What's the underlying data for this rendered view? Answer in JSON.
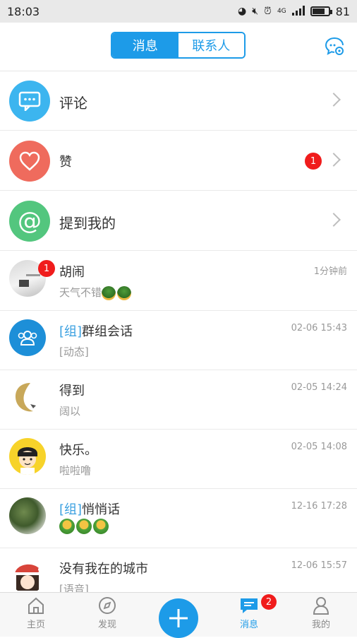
{
  "status_bar": {
    "time": "18:03",
    "network": "4G",
    "battery": "81",
    "battery_level": 0.81
  },
  "header": {
    "tabs": [
      {
        "label": "消息",
        "active": true
      },
      {
        "label": "联系人",
        "active": false
      }
    ],
    "chat_settings_icon": "chat-settings-icon"
  },
  "notifications": [
    {
      "label": "评论",
      "icon": "comment-icon",
      "color": "#3cb5ef",
      "badge": null
    },
    {
      "label": "赞",
      "icon": "heart-icon",
      "color": "#ef6b5d",
      "badge": "1"
    },
    {
      "label": "提到我的",
      "icon": "at-icon",
      "color": "#53c67e",
      "badge": null
    }
  ],
  "conversations": [
    {
      "name": "胡闹",
      "tag": "",
      "preview": "天气不错",
      "time": "1分钟前",
      "badge": "1"
    },
    {
      "name": "群组会话",
      "tag": "[组]",
      "preview": "[动态]",
      "time": "02-06 15:43",
      "badge": null
    },
    {
      "name": "得到",
      "tag": "",
      "preview": "阔以",
      "time": "02-05 14:24",
      "badge": null
    },
    {
      "name": "快乐。",
      "tag": "",
      "preview": "啦啦噜",
      "time": "02-05 14:08",
      "badge": null
    },
    {
      "name": "悄悄话",
      "tag": "[组]",
      "preview": "",
      "time": "12-16 17:28",
      "badge": null
    },
    {
      "name": "没有我在的城市",
      "tag": "",
      "preview": "[语音]",
      "time": "12-06 15:57",
      "badge": null
    }
  ],
  "tab_bar": {
    "items": [
      {
        "label": "主页",
        "icon": "home-icon",
        "active": false
      },
      {
        "label": "发现",
        "icon": "compass-icon",
        "active": false
      },
      {
        "label": "",
        "icon": "plus-icon",
        "active": false
      },
      {
        "label": "消息",
        "icon": "message-icon",
        "active": true,
        "badge": "2"
      },
      {
        "label": "我的",
        "icon": "profile-icon",
        "active": false
      }
    ]
  },
  "colors": {
    "accent": "#1d9be8",
    "badge": "#f01c1c"
  }
}
